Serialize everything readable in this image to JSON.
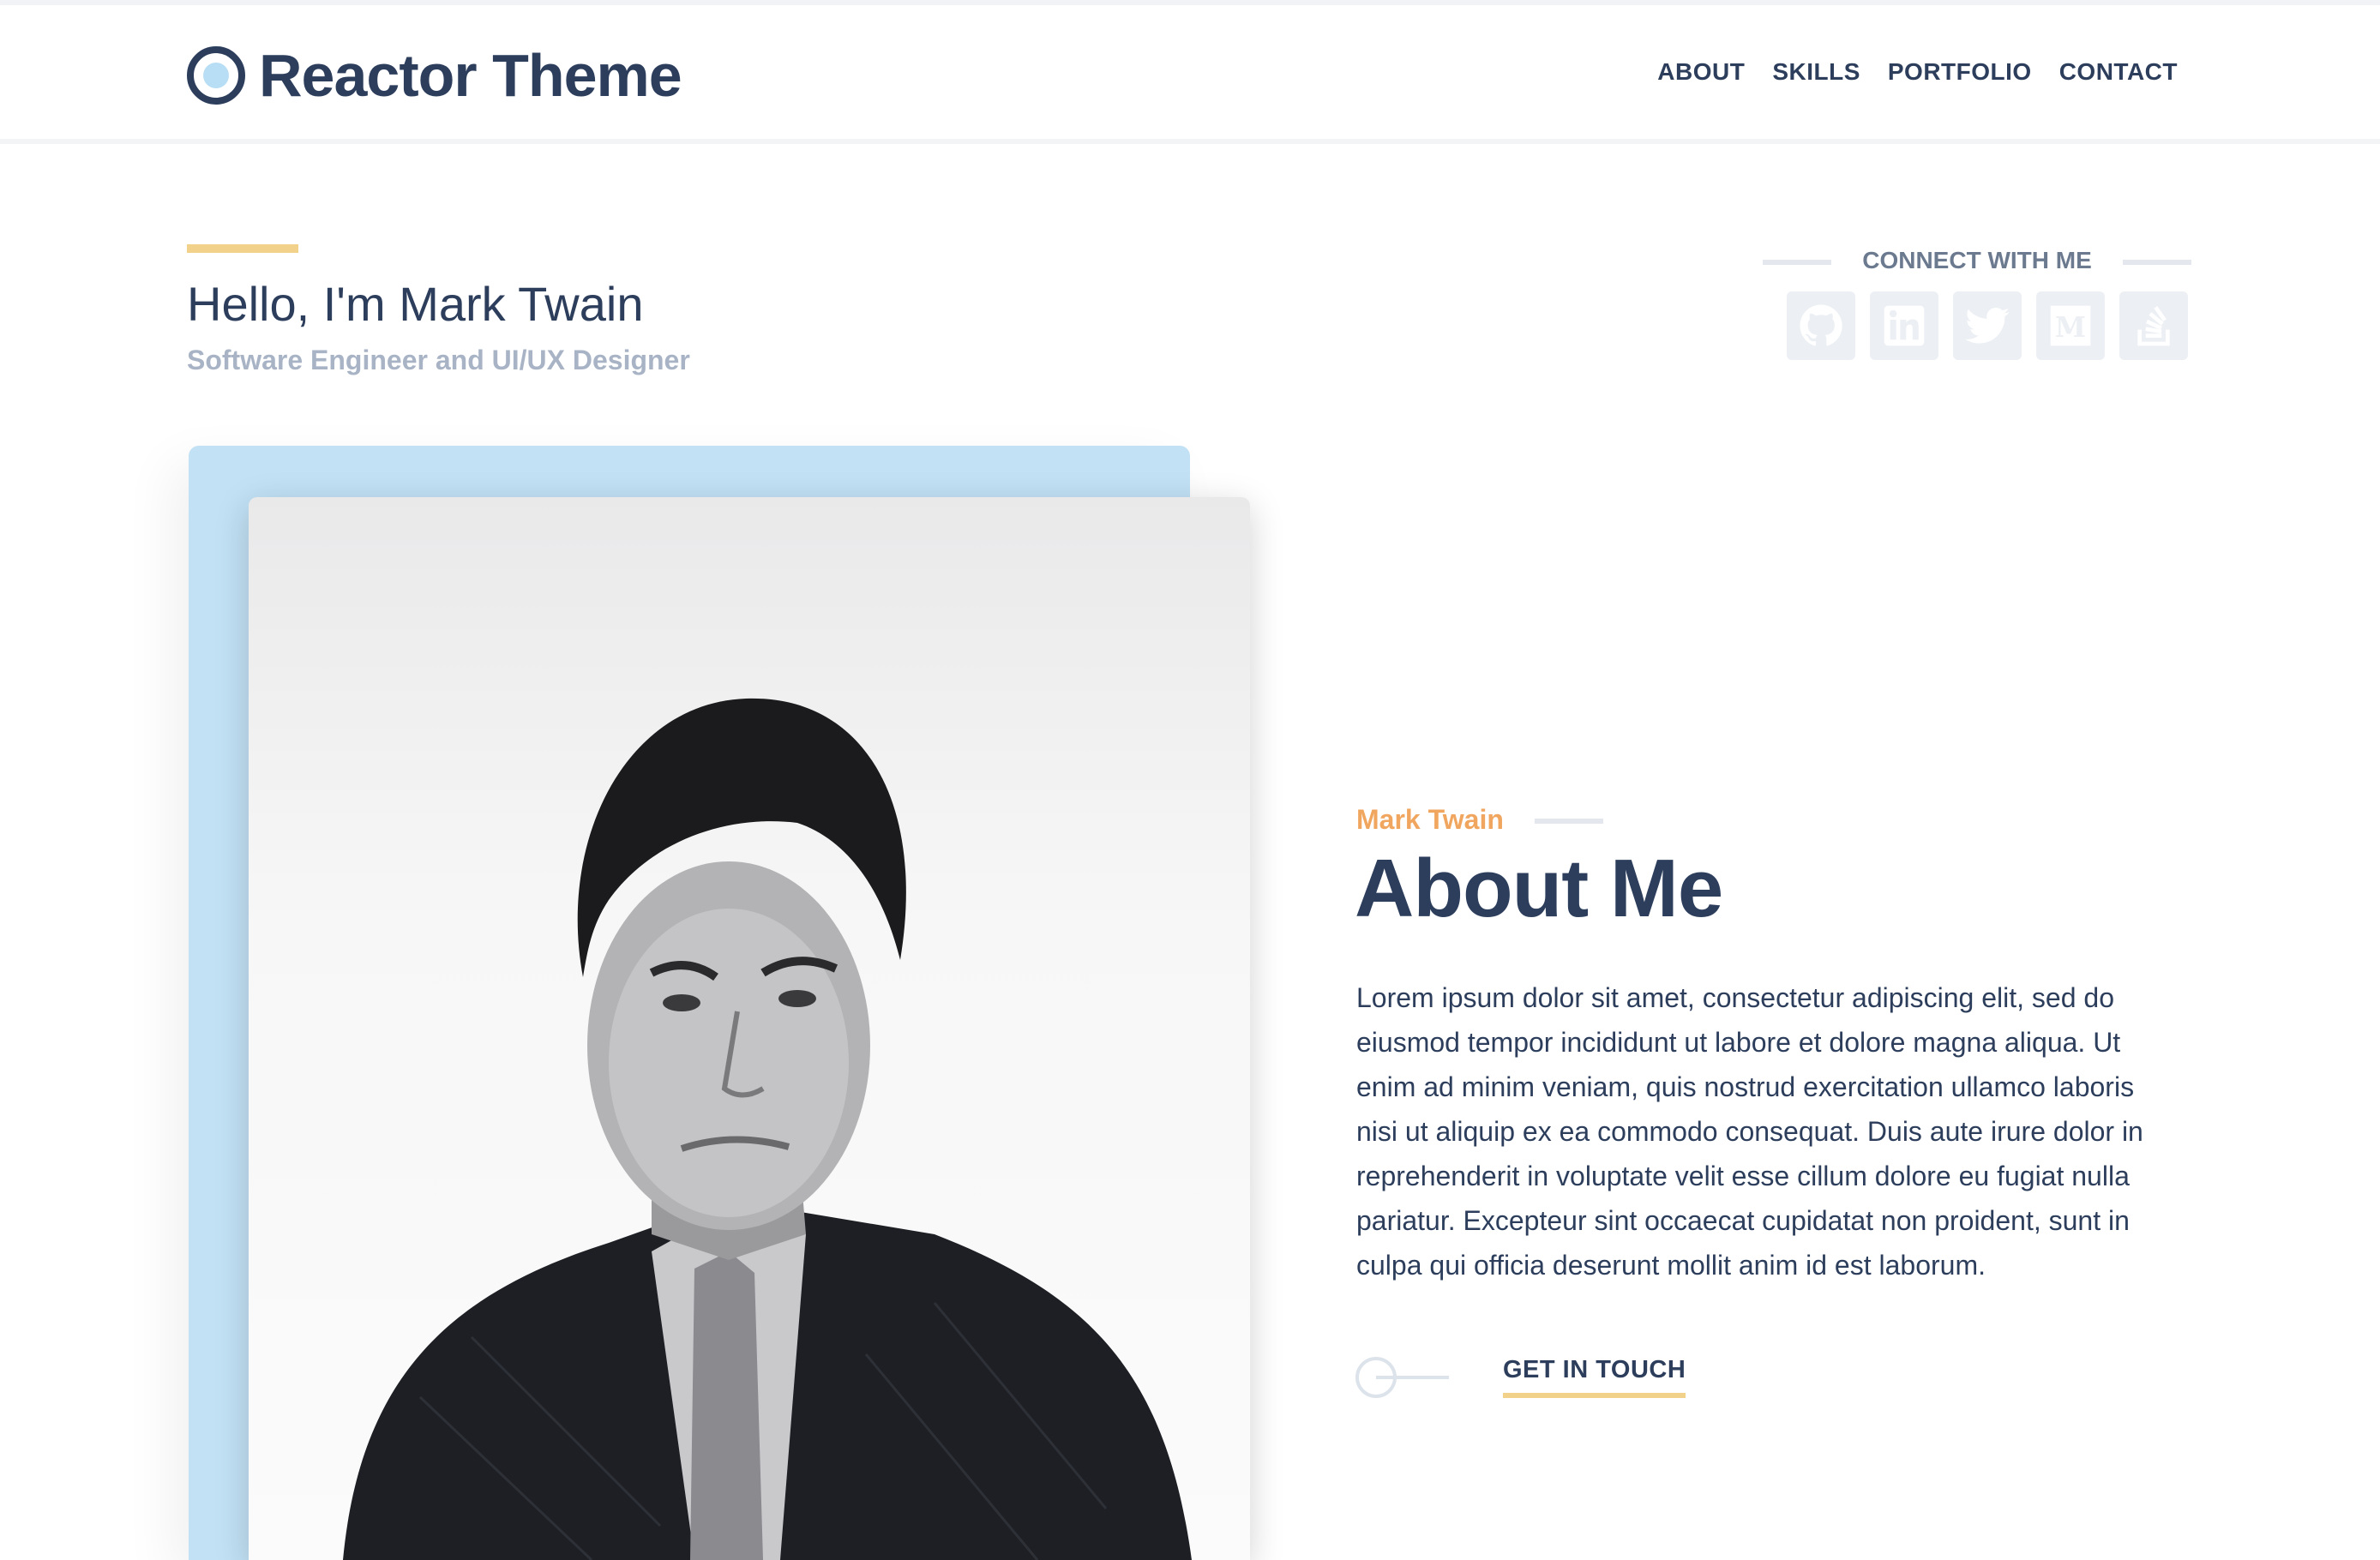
{
  "header": {
    "logo_text": "Reactor Theme",
    "nav": [
      "ABOUT",
      "SKILLS",
      "PORTFOLIO",
      "CONTACT"
    ]
  },
  "hero": {
    "greeting": "Hello, I'm Mark Twain",
    "subtitle": "Software Engineer and UI/UX Designer"
  },
  "connect": {
    "label": "CONNECT WITH ME",
    "icons": [
      "github-icon",
      "linkedin-icon",
      "twitter-icon",
      "medium-icon",
      "stackoverflow-icon"
    ]
  },
  "about": {
    "kicker": "Mark Twain",
    "title": "About Me",
    "body": "Lorem ipsum dolor sit amet, consectetur adipiscing elit, sed do eiusmod tempor incididunt ut labore et dolore magna aliqua. Ut enim ad minim veniam, quis nostrud exercitation ullamco laboris nisi ut aliquip ex ea commodo consequat. Duis aute irure dolor in reprehenderit in voluptate velit esse cillum dolore eu fugiat nulla pariatur. Excepteur sint occaecat cupidatat non proident, sunt in culpa qui officia deserunt mollit anim id est laborum.",
    "cta": "GET IN TOUCH"
  },
  "colors": {
    "primary": "#2c3e5c",
    "accent_yellow": "#f2d28a",
    "accent_orange": "#f0a65e",
    "light_blue": "#c2e1f5",
    "muted": "#a8b4c6"
  }
}
